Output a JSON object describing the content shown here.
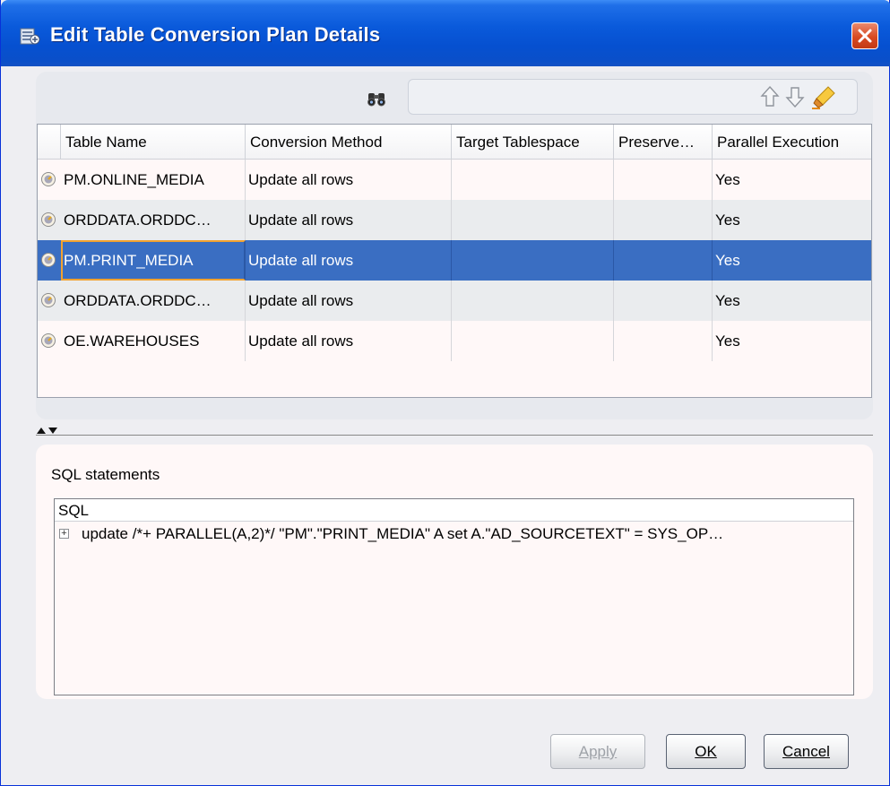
{
  "window": {
    "title": "Edit Table Conversion Plan Details",
    "colors": {
      "title_bar": "#0650d0",
      "selection": "#3a6ec2",
      "focus_border": "#f2a230",
      "close_button": "#d84a22"
    }
  },
  "toolbar": {
    "search_placeholder": "",
    "icons": [
      "binoculars-icon",
      "arrow-up-icon",
      "arrow-down-icon",
      "highlighter-icon"
    ]
  },
  "table": {
    "columns": [
      "Table Name",
      "Conversion Method",
      "Target Tablespace",
      "Preserve…",
      "Parallel Execution"
    ],
    "rows": [
      {
        "table_name": "PM.ONLINE_MEDIA",
        "conversion_method": "Update all rows",
        "target_tablespace": "",
        "preserve": "",
        "parallel_execution": "Yes"
      },
      {
        "table_name": "ORDDATA.ORDDC…",
        "conversion_method": "Update all rows",
        "target_tablespace": "",
        "preserve": "",
        "parallel_execution": "Yes"
      },
      {
        "table_name": "PM.PRINT_MEDIA",
        "conversion_method": "Update all rows",
        "target_tablespace": "",
        "preserve": "",
        "parallel_execution": "Yes"
      },
      {
        "table_name": "ORDDATA.ORDDC…",
        "conversion_method": "Update all rows",
        "target_tablespace": "",
        "preserve": "",
        "parallel_execution": "Yes"
      },
      {
        "table_name": "OE.WAREHOUSES",
        "conversion_method": "Update all rows",
        "target_tablespace": "",
        "preserve": "",
        "parallel_execution": "Yes"
      }
    ],
    "selected_row": 2
  },
  "sql_panel": {
    "label": "SQL statements",
    "column_header": "SQL",
    "statements": [
      "update  /*+ PARALLEL(A,2)*/ \"PM\".\"PRINT_MEDIA\" A  set A.\"AD_SOURCETEXT\" = SYS_OP…"
    ]
  },
  "buttons": {
    "apply": "Apply",
    "ok": "OK",
    "cancel": "Cancel"
  }
}
